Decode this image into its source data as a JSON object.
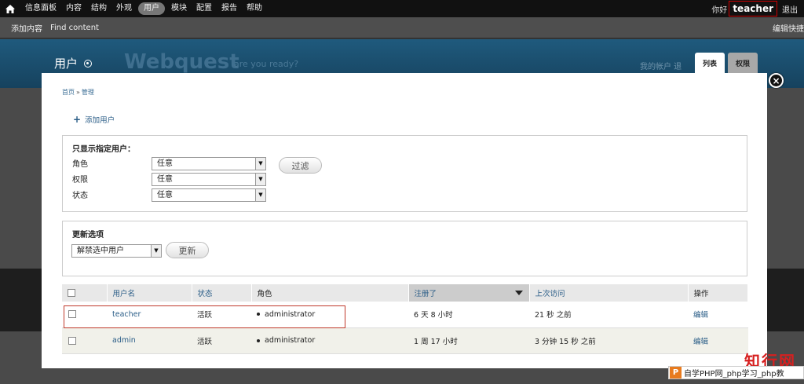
{
  "toolbar": {
    "menu": [
      "信息面板",
      "内容",
      "结构",
      "外观",
      "用户",
      "模块",
      "配置",
      "报告",
      "帮助"
    ],
    "active_index": 4,
    "greeting": "你好",
    "username": "teacher",
    "logout": "退出"
  },
  "shortcuts": {
    "items": [
      "添加内容",
      "Find content"
    ],
    "edit": "编辑快捷"
  },
  "branding": {
    "page_title": "用户",
    "site_name": "Webquest",
    "slogan": "are you ready?",
    "secondary": "我的帐户  退",
    "tabs": [
      "列表",
      "权限"
    ],
    "active_tab": 0
  },
  "overlay": {
    "close": "×",
    "breadcrumb": [
      "首页",
      "管理"
    ],
    "breadcrumb_sep": "»",
    "add_user": "添加用户",
    "filter": {
      "legend": "只显示指定用户：",
      "rows": [
        {
          "label": "角色",
          "value": "任意"
        },
        {
          "label": "权限",
          "value": "任意"
        },
        {
          "label": "状态",
          "value": "任意"
        }
      ],
      "filter_button": "过滤"
    },
    "update": {
      "legend": "更新选项",
      "selected_option": "解禁选中用户",
      "update_button": "更新"
    },
    "table": {
      "headers": [
        "用户名",
        "状态",
        "角色",
        "注册了",
        "上次访问",
        "操作"
      ],
      "rows": [
        {
          "username": "teacher",
          "status": "活跃",
          "role": "administrator",
          "registered": "6 天 8 小时",
          "last_access": "21 秒 之前",
          "action": "编辑"
        },
        {
          "username": "admin",
          "status": "活跃",
          "role": "administrator",
          "registered": "1 周 17 小时",
          "last_access": "3 分钟 15 秒 之前",
          "action": "编辑"
        }
      ]
    }
  },
  "watermark": {
    "big": "知行网",
    "logo_letter": "P",
    "bar_text": "自学PHP网_php学习_php教"
  },
  "colors": {
    "toolbar_bg": "#111111",
    "branding_bg": "#1f5a7d",
    "link": "#2a5d87",
    "highlight_border": "#c0392b"
  }
}
